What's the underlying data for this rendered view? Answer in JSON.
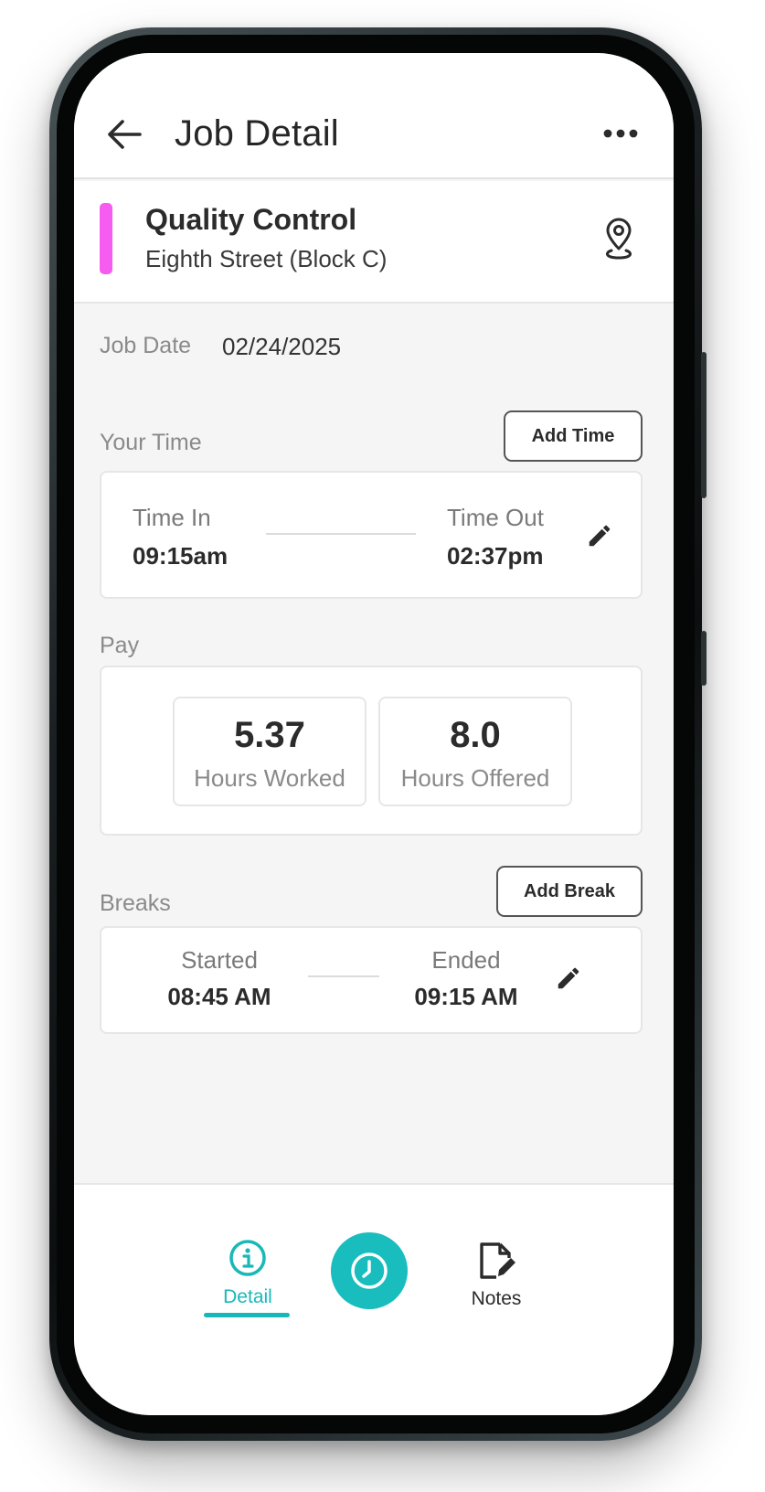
{
  "header": {
    "title": "Job Detail"
  },
  "job": {
    "title": "Quality Control",
    "location": "Eighth Street (Block C)",
    "accent_color": "#f75cf0"
  },
  "job_date": {
    "label": "Job Date",
    "value": "02/24/2025"
  },
  "your_time": {
    "label": "Your Time",
    "add_button": "Add Time",
    "time_in_label": "Time In",
    "time_in_value": "09:15am",
    "time_out_label": "Time Out",
    "time_out_value": "02:37pm"
  },
  "pay": {
    "label": "Pay",
    "hours_worked_value": "5.37",
    "hours_worked_label": "Hours Worked",
    "hours_offered_value": "8.0",
    "hours_offered_label": "Hours Offered"
  },
  "breaks": {
    "label": "Breaks",
    "add_button": "Add Break",
    "started_label": "Started",
    "started_value": "08:45 AM",
    "ended_label": "Ended",
    "ended_value": "09:15 AM"
  },
  "nav": {
    "detail_label": "Detail",
    "notes_label": "Notes",
    "active_tab": "Detail",
    "accent_color": "#19b8b8"
  },
  "icons": {
    "back": "arrow-left-icon",
    "more": "more-horizontal-icon",
    "location": "map-pin-icon",
    "edit": "pencil-icon",
    "detail": "info-icon",
    "clock": "clock-icon",
    "notes": "edit-note-icon"
  }
}
